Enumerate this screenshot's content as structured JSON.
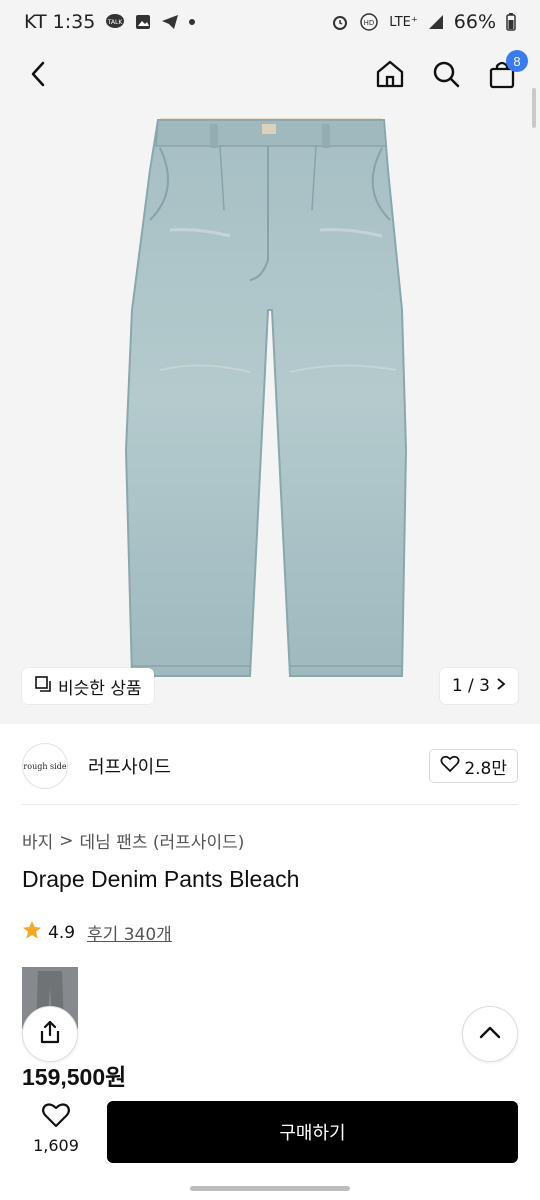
{
  "status_bar": {
    "carrier_time": "KT 1:35",
    "left_icons": [
      "talk-icon",
      "gallery-icon",
      "telegram-icon",
      "dot-icon"
    ],
    "right_icons": [
      "alarm-icon",
      "hd-icon",
      "lte-signal-icon",
      "signal-bars-icon",
      "battery-icon"
    ],
    "lte_label": "LTE⁺",
    "battery_percent": "66%"
  },
  "header": {
    "icons": [
      "back-icon",
      "home-icon",
      "search-icon",
      "cart-icon"
    ],
    "cart_badge": "8"
  },
  "hero": {
    "image": "jeans-image",
    "similar_label": "비슷한 상품",
    "counter": "1 / 3",
    "colors": {
      "denim": "#a9c1c6",
      "denim_dark": "#8aa7ae",
      "background": "#f4f4f4"
    }
  },
  "brand": {
    "logo_text": "rough side",
    "name": "러프사이드",
    "likes": "2.8만"
  },
  "breadcrumb": {
    "category": "바지",
    "separator": ">",
    "subcategory": "데님 팬츠 (러프사이드)"
  },
  "product": {
    "title": "Drape Denim Pants Bleach",
    "rating": "4.9",
    "review_label": "후기 340개",
    "price": "159,500원"
  },
  "bottom_bar": {
    "wish_count": "1,609",
    "buy_label": "구매하기"
  },
  "colors": {
    "accent_badge": "#3a7bf0",
    "star": "#f5a623",
    "buy_button": "#000000"
  }
}
